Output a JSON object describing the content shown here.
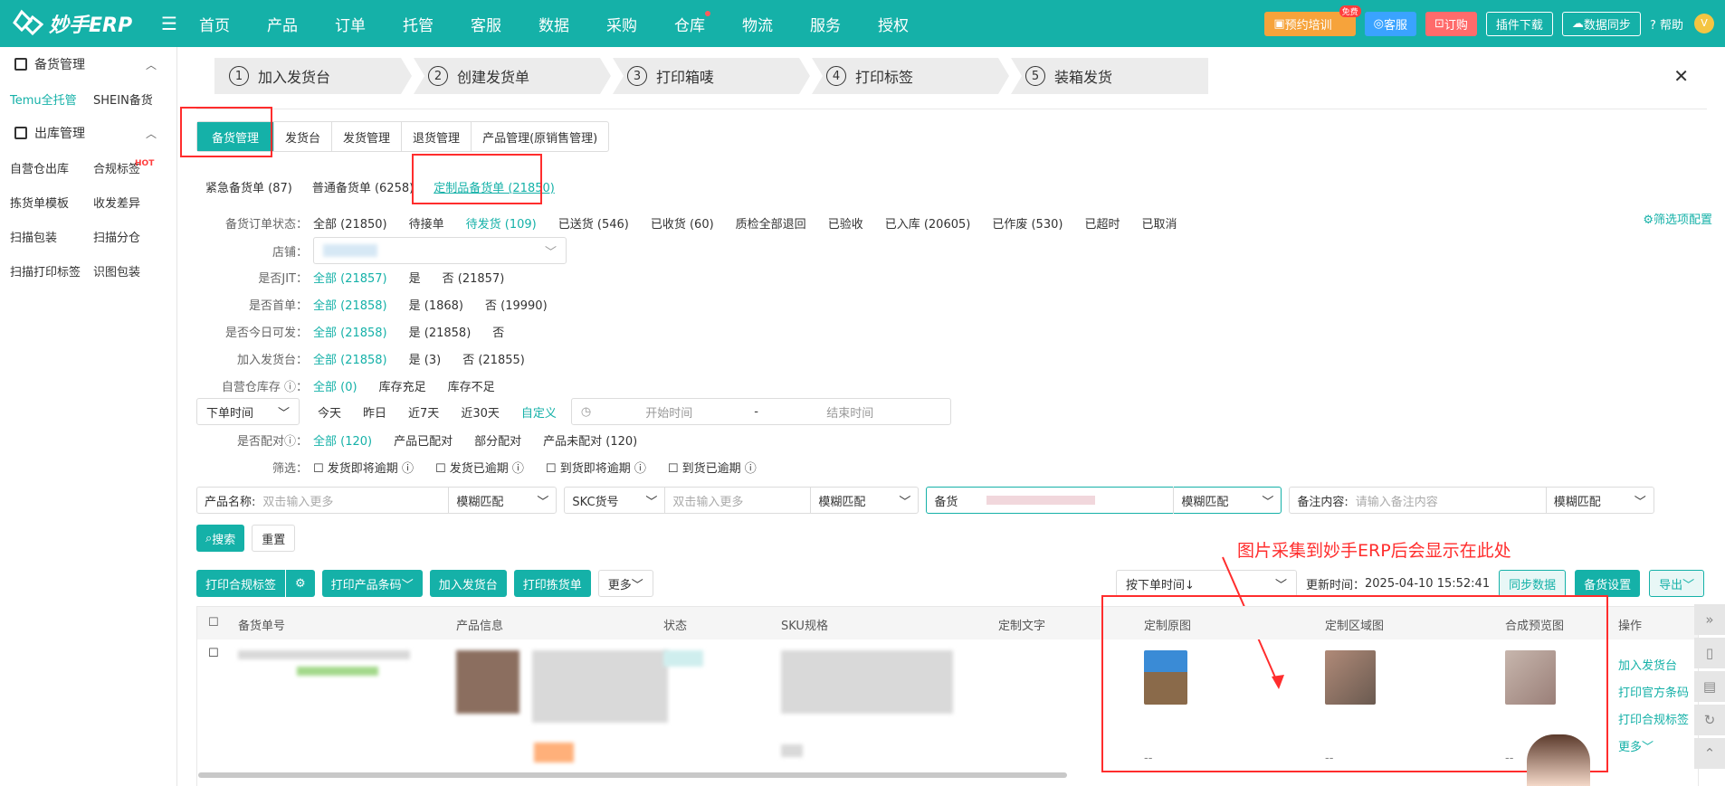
{
  "app": {
    "title": "妙手ERP"
  },
  "topnav": {
    "items": [
      "首页",
      "产品",
      "订单",
      "托管",
      "客服",
      "数据",
      "采购",
      "仓库",
      "物流",
      "服务",
      "授权"
    ],
    "train": "预约培训",
    "train_badge": "免费",
    "service": "客服",
    "order": "订购",
    "plugin": "插件下载",
    "sync": "数据同步",
    "help": "帮助"
  },
  "sidebar": {
    "group1": "备货管理",
    "group1_items": [
      "Temu全托管",
      "SHEIN备货"
    ],
    "group2": "出库管理",
    "group2_items": [
      "自营仓出库",
      "合规标签",
      "拣货单模板",
      "收发差异",
      "扫描包装",
      "扫描分仓",
      "扫描打印标签",
      "识图包装"
    ],
    "hot": "HOT"
  },
  "steps": [
    {
      "num": "1",
      "label": "加入发货台"
    },
    {
      "num": "2",
      "label": "创建发货单"
    },
    {
      "num": "3",
      "label": "打印箱唛"
    },
    {
      "num": "4",
      "label": "打印标签"
    },
    {
      "num": "5",
      "label": "装箱发货"
    }
  ],
  "tabs": [
    "备货管理",
    "发货台",
    "发货管理",
    "退货管理",
    "产品管理(原销售管理)"
  ],
  "subtabs": [
    "紧急备货单 (87)",
    "普通备货单 (6258)",
    "定制品备货单 (21850)"
  ],
  "filters": {
    "status_label": "备货订单状态：",
    "status_opts": [
      "全部 (21850)",
      "待接单",
      "待发货 (109)",
      "已送货 (546)",
      "已收货 (60)",
      "质检全部退回",
      "已验收",
      "已入库 (20605)",
      "已作废 (530)",
      "已超时",
      "已取消"
    ],
    "store_label": "店铺：",
    "jit_label": "是否JIT：",
    "jit_opts": [
      "全部 (21857)",
      "是",
      "否 (21857)"
    ],
    "first_label": "是否首单：",
    "first_opts": [
      "全部 (21858)",
      "是 (1868)",
      "否 (19990)"
    ],
    "today_label": "是否今日可发：",
    "today_opts": [
      "全部 (21858)",
      "是 (21858)",
      "否"
    ],
    "add_label": "加入发货台：",
    "add_opts": [
      "全部 (21858)",
      "是 (3)",
      "否 (21855)"
    ],
    "stock_label": "自营仓库存",
    "stock_opts": [
      "全部 (0)",
      "库存充足",
      "库存不足"
    ],
    "time_select": "下单时间",
    "time_opts": [
      "今天",
      "昨日",
      "近7天",
      "近30天",
      "自定义"
    ],
    "start_ph": "开始时间",
    "end_ph": "结束时间",
    "dash": "-",
    "match_label": "是否配对",
    "match_opts": [
      "全部 (120)",
      "产品已配对",
      "部分配对",
      "产品未配对 (120)"
    ],
    "screen_label": "筛选：",
    "screen_opts": [
      "发货即将逾期",
      "发货已逾期",
      "到货即将逾期",
      "到货已逾期"
    ],
    "config": "筛选项配置"
  },
  "search": {
    "name_label": "产品名称:",
    "name_ph": "双击输入更多",
    "fuzzy": "模糊匹配",
    "skc_label": "SKC货号",
    "skc_ph": "双击输入更多",
    "stock_label": "备货",
    "remark_label": "备注内容:",
    "remark_ph": "请输入备注内容",
    "search_btn": "搜索",
    "reset_btn": "重置"
  },
  "actions": {
    "print_compliance": "打印合规标签",
    "print_barcode": "打印产品条码",
    "add_shipping": "加入发货台",
    "print_pick": "打印拣货单",
    "more": "更多",
    "sort": "按下单时间↓",
    "update_label": "更新时间：",
    "update_time": "2025-04-10 15:52:41",
    "sync": "同步数据",
    "stock_settings": "备货设置",
    "export": "导出"
  },
  "annotation": "图片采集到妙手ERP后会显示在此处",
  "table": {
    "headers": [
      "备货单号",
      "产品信息",
      "状态",
      "SKU规格",
      "定制文字",
      "定制原图",
      "定制区域图",
      "合成预览图",
      "操作"
    ],
    "row": {
      "ops": [
        "加入发货台",
        "打印官方条码",
        "打印合规标签",
        "更多"
      ],
      "placeholder": "--"
    }
  },
  "colors": {
    "brand": "#15b1a8",
    "alert": "#ff2d2d"
  }
}
